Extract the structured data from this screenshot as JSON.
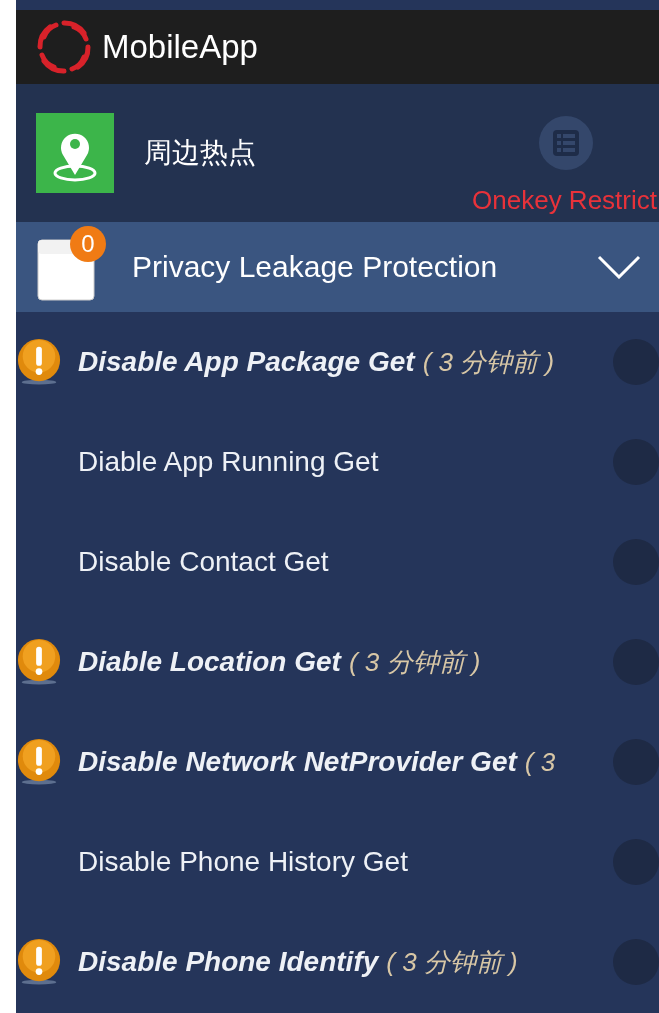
{
  "app_bar": {
    "title": "MobileApp"
  },
  "header": {
    "hotspot_label": "周边热点",
    "restrict_label": "Onekey Restrict"
  },
  "section": {
    "title": "Privacy Leakage Protection",
    "badge": "0",
    "expanded": false
  },
  "items": [
    {
      "name": "Disable App Package Get",
      "alert": true,
      "time": "( 3 分钟前 )",
      "on": false
    },
    {
      "name": "Diable App Running Get",
      "alert": false,
      "on": false
    },
    {
      "name": "Disable Contact Get",
      "alert": false,
      "on": false
    },
    {
      "name": "Diable Location Get",
      "alert": true,
      "time": "( 3 分钟前 )",
      "on": false
    },
    {
      "name": "Disable Network NetProvider Get",
      "alert": true,
      "time": "( 3",
      "on": false
    },
    {
      "name": "Disable Phone History Get",
      "alert": false,
      "on": false
    },
    {
      "name": "Disable Phone Identify",
      "alert": true,
      "time": "( 3 分钟前 )",
      "on": false
    }
  ]
}
